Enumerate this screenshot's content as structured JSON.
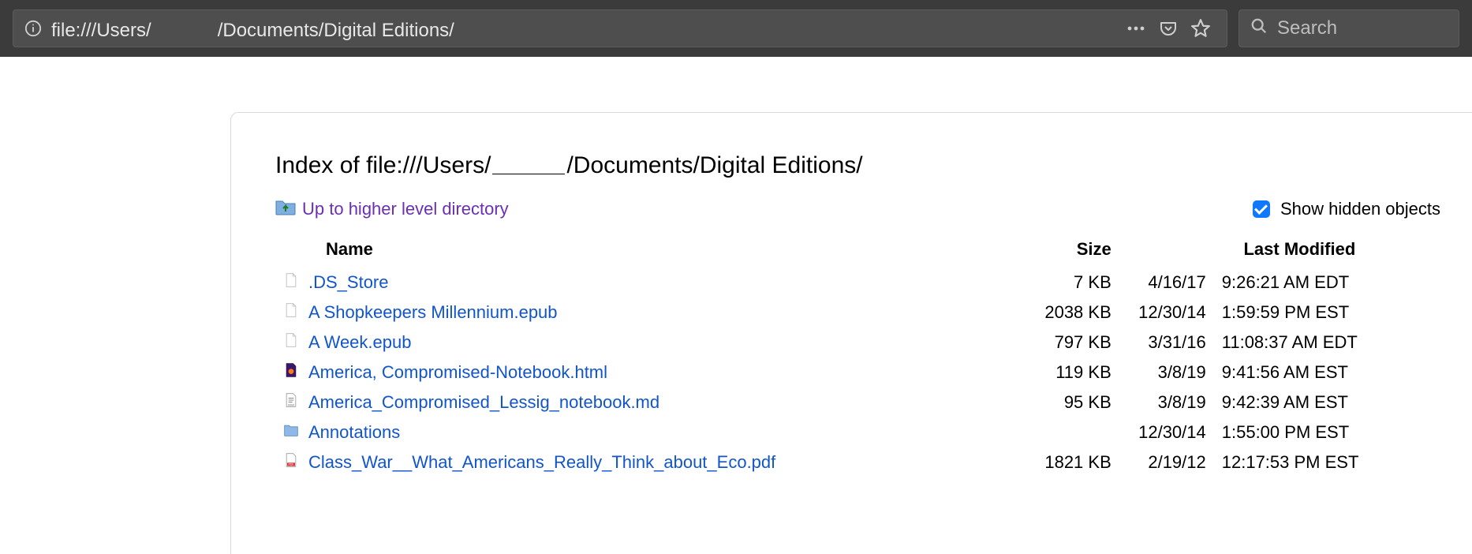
{
  "toolbar": {
    "url_prefix": "file:///Users/",
    "url_suffix": "/Documents/Digital Editions/",
    "search_placeholder": "Search"
  },
  "page": {
    "title_prefix": "Index of file:///Users/",
    "title_suffix": "/Documents/Digital Editions/",
    "up_link_label": "Up to higher level directory",
    "show_hidden_label": "Show hidden objects",
    "show_hidden_checked": true,
    "columns": {
      "name": "Name",
      "size": "Size",
      "modified": "Last Modified"
    },
    "entries": [
      {
        "icon": "file",
        "name": ".DS_Store",
        "size": "7 KB",
        "date": "4/16/17",
        "time": "9:26:21 AM EDT"
      },
      {
        "icon": "file",
        "name": "A Shopkeepers Millennium.epub",
        "size": "2038 KB",
        "date": "12/30/14",
        "time": "1:59:59 PM EST"
      },
      {
        "icon": "file",
        "name": "A Week.epub",
        "size": "797 KB",
        "date": "3/31/16",
        "time": "11:08:37 AM EDT"
      },
      {
        "icon": "html",
        "name": "America, Compromised-Notebook.html",
        "size": "119 KB",
        "date": "3/8/19",
        "time": "9:41:56 AM EST"
      },
      {
        "icon": "text",
        "name": "America_Compromised_Lessig_notebook.md",
        "size": "95 KB",
        "date": "3/8/19",
        "time": "9:42:39 AM EST"
      },
      {
        "icon": "folder",
        "name": "Annotations",
        "size": "",
        "date": "12/30/14",
        "time": "1:55:00 PM EST"
      },
      {
        "icon": "pdf",
        "name": "Class_War__What_Americans_Really_Think_about_Eco.pdf",
        "size": "1821 KB",
        "date": "2/19/12",
        "time": "12:17:53 PM EST"
      }
    ]
  }
}
